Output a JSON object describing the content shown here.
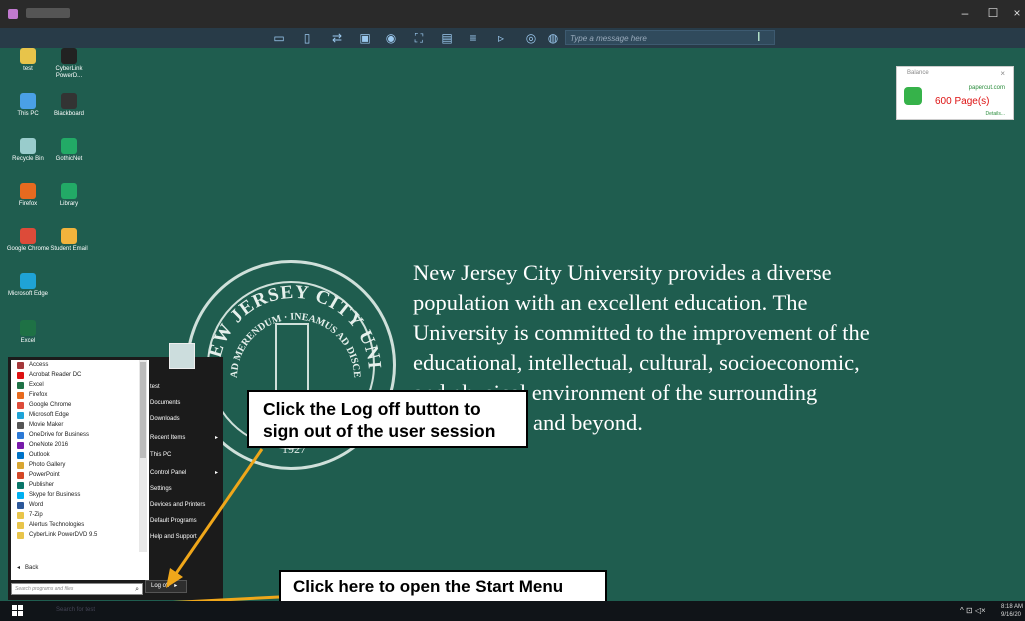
{
  "window": {
    "minimize_glyph": "–",
    "maximize_glyph": "☐",
    "close_glyph": "×"
  },
  "remote_toolbar": {
    "message_placeholder": "Type a message here",
    "icons": [
      "monitor-red-icon",
      "clipboard-icon",
      "transfer-icon",
      "screen-icon",
      "eye-icon",
      "fullscreen-icon",
      "print-icon",
      "settings-icon",
      "file-icon",
      "record-icon",
      "chat-icon"
    ]
  },
  "desktop_icons": [
    {
      "label": "test",
      "icon": "user-file-icon",
      "color": "#e8c44a"
    },
    {
      "label": "CyberLink PowerD...",
      "icon": "cyberlink-icon",
      "color": "#222"
    },
    {
      "label": "This PC",
      "icon": "this-pc-icon",
      "color": "#4aa0e6"
    },
    {
      "label": "Blackboard",
      "icon": "blackboard-icon",
      "color": "#333"
    },
    {
      "label": "Recycle Bin",
      "icon": "recycle-bin-icon",
      "color": "#9cc"
    },
    {
      "label": "GothicNet",
      "icon": "gothicnet-icon",
      "color": "#2a6"
    },
    {
      "label": "Firefox",
      "icon": "firefox-icon",
      "color": "#e66a1f"
    },
    {
      "label": "Library",
      "icon": "library-icon",
      "color": "#2a6"
    },
    {
      "label": "Google Chrome",
      "icon": "chrome-icon",
      "color": "#dd4b39"
    },
    {
      "label": "Student Email",
      "icon": "email-icon",
      "color": "#f2b33c"
    },
    {
      "label": "Microsoft Edge",
      "icon": "edge-icon",
      "color": "#1fa3d6"
    },
    {
      "label": "Excel",
      "icon": "excel-icon",
      "color": "#1e7145"
    }
  ],
  "balance_widget": {
    "title": "Balance",
    "site": "papercut.com",
    "pages": "600 Page(s)",
    "details": "Details..."
  },
  "tagline": "New Jersey City University provides a diverse population with an excellent education. The University is committed to the improvement of the educational, intellectual, cultural, socioeconomic, and physical environment of the surrounding urban region and beyond.",
  "seal": {
    "top_text": "NEW JERSEY CITY UNIVERSITY",
    "motto": "AD MERENDUM · INEAMUS AD DISCENDUM",
    "year": "1927"
  },
  "start_menu": {
    "programs": [
      {
        "label": "Access",
        "color": "#a4373a"
      },
      {
        "label": "Acrobat Reader DC",
        "color": "#d11"
      },
      {
        "label": "Excel",
        "color": "#1e7145"
      },
      {
        "label": "Firefox",
        "color": "#e66a1f"
      },
      {
        "label": "Google Chrome",
        "color": "#dd4b39"
      },
      {
        "label": "Microsoft Edge",
        "color": "#1fa3d6"
      },
      {
        "label": "Movie Maker",
        "color": "#555"
      },
      {
        "label": "OneDrive for Business",
        "color": "#2b79d6"
      },
      {
        "label": "OneNote 2016",
        "color": "#7719aa"
      },
      {
        "label": "Outlook",
        "color": "#0072c6"
      },
      {
        "label": "Photo Gallery",
        "color": "#d8a531"
      },
      {
        "label": "PowerPoint",
        "color": "#d24726"
      },
      {
        "label": "Publisher",
        "color": "#077568"
      },
      {
        "label": "Skype for Business",
        "color": "#00aff0"
      },
      {
        "label": "Word",
        "color": "#2b579a"
      },
      {
        "label": "7-Zip",
        "color": "#e8c44a"
      },
      {
        "label": "Alertus Technologies",
        "color": "#e8c44a"
      },
      {
        "label": "CyberLink PowerDVD 9.5",
        "color": "#e8c44a"
      }
    ],
    "back_label": "Back",
    "search_placeholder": "Search programs and files",
    "right_items": [
      {
        "label": "test",
        "arrow": ""
      },
      {
        "label": "Documents",
        "arrow": ""
      },
      {
        "label": "Downloads",
        "arrow": ""
      },
      {
        "label": "Recent Items",
        "arrow": "▸"
      },
      {
        "label": "This PC",
        "arrow": ""
      },
      {
        "label": "Control Panel",
        "arrow": "▸"
      },
      {
        "label": "Settings",
        "arrow": ""
      },
      {
        "label": "Devices and Printers",
        "arrow": ""
      },
      {
        "label": "Default Programs",
        "arrow": ""
      },
      {
        "label": "Help and Support",
        "arrow": ""
      }
    ],
    "logoff_label": "Log off",
    "logoff_arrow": "▸"
  },
  "callouts": {
    "logoff_line1": "Click the Log off button to",
    "logoff_line2": "sign out of the user session",
    "start": "Click here to open the Start Menu"
  },
  "taskbar": {
    "search_text": "Search for test",
    "tray_icons": "^ ⊡ ◁×",
    "time": "8:18 AM",
    "date": "9/16/20"
  },
  "colors": {
    "desktop": "#1f5d4f",
    "arrow": "#f0a71a",
    "callout_border": "#000000"
  }
}
